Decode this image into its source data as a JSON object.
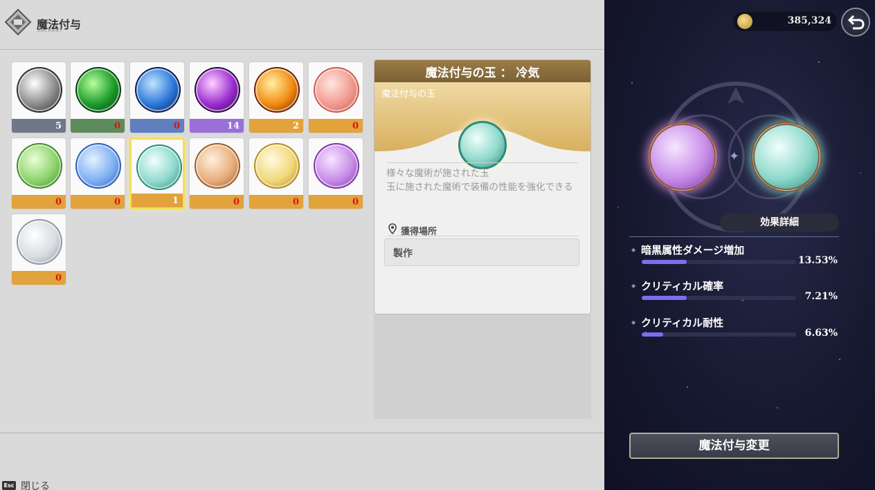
{
  "header": {
    "title": "魔法付与",
    "subtitle": "ENCHANT"
  },
  "inventory": {
    "items": [
      {
        "icon": "white-orb-icon",
        "count": "5",
        "colors": [
          "#ffffff",
          "#8a8a8a",
          "#2b2b2b"
        ],
        "band": "#6e7889"
      },
      {
        "icon": "green-orb-icon",
        "count": "0",
        "colors": [
          "#b6ff9c",
          "#1c9a2a",
          "#053b0b"
        ],
        "band": "#5c8c5c"
      },
      {
        "icon": "blue-orb-icon",
        "count": "0",
        "colors": [
          "#bfe4ff",
          "#2c76d8",
          "#081a4a"
        ],
        "band": "#5f7fbf"
      },
      {
        "icon": "purple-orb-icon",
        "count": "14",
        "colors": [
          "#ffd1ff",
          "#9a2cd0",
          "#2b0740"
        ],
        "band": "#9a6fd8"
      },
      {
        "icon": "orange-orb-icon",
        "count": "2",
        "colors": [
          "#fff0a0",
          "#f28a12",
          "#6a1e00"
        ],
        "band": "#e2a23c"
      },
      {
        "icon": "red-gem-icon",
        "count": "0",
        "colors": [
          "#ffe6e0",
          "#f19a8f",
          "#c85a4e"
        ],
        "band": "#e2a23c"
      },
      {
        "icon": "green-gem-icon",
        "count": "0",
        "colors": [
          "#eaffd8",
          "#8ed46c",
          "#3f8a2a"
        ],
        "band": "#e2a23c"
      },
      {
        "icon": "blue-gem-icon",
        "count": "0",
        "colors": [
          "#e6f1ff",
          "#7fb0f3",
          "#2a5eb8"
        ],
        "band": "#e2a23c"
      },
      {
        "icon": "cyan-gem-icon",
        "count": "1",
        "colors": [
          "#f0fffb",
          "#8fd9cc",
          "#2b8a7c"
        ],
        "band": "#e2a23c"
      },
      {
        "icon": "bronze-gem-icon",
        "count": "0",
        "colors": [
          "#fff0e0",
          "#e8ae7c",
          "#9a5a2a"
        ],
        "band": "#e2a23c"
      },
      {
        "icon": "yellow-gem-icon",
        "count": "0",
        "colors": [
          "#fffbe0",
          "#f1d87a",
          "#b48a1c"
        ],
        "band": "#e2a23c"
      },
      {
        "icon": "violet-gem-icon",
        "count": "0",
        "colors": [
          "#f6e6ff",
          "#c88de8",
          "#7a34a8"
        ],
        "band": "#e2a23c"
      },
      {
        "icon": "silver-gem-icon",
        "count": "0",
        "colors": [
          "#ffffff",
          "#d8dde2",
          "#8e969e"
        ],
        "band": "#e2a23c"
      }
    ],
    "selected_index": 8
  },
  "detail": {
    "title": "魔法付与の玉 ： 冷気",
    "type": "魔法付与の玉",
    "description": "様々な魔術が施された玉\n玉に施された魔術で装備の性能を強化できる",
    "acquisition_label": "獲得場所",
    "acquisition_value": "製作"
  },
  "currency": {
    "icon": "gold-coin-icon",
    "value": "385,324"
  },
  "equipped": {
    "left_gem": "violet-gem-icon",
    "right_gem": "cyan-gem-icon"
  },
  "effects": {
    "tab_label": "効果詳細",
    "stats": [
      {
        "name": "暗黒属性ダメージ増加",
        "value": "13.53%",
        "fill": 0.29
      },
      {
        "name": "クリティカル確率",
        "value": "7.21%",
        "fill": 0.29
      },
      {
        "name": "クリティカル耐性",
        "value": "6.63%",
        "fill": 0.14
      }
    ]
  },
  "actions": {
    "change_label": "魔法付与変更",
    "esc_key": "Esc",
    "close_label": "閉じる"
  },
  "colors": {
    "accent_bar": "#7b6ff0",
    "zero_count": "#d11111",
    "selected_border": "#f2df5a"
  }
}
